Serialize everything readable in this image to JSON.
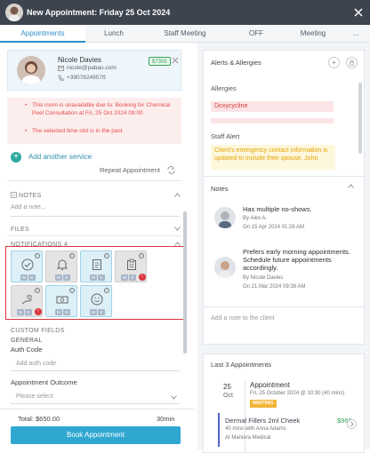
{
  "window": {
    "title": "New Appointment: Friday 25 Oct 2024"
  },
  "tabs": [
    {
      "label": "Appointments",
      "active": true
    },
    {
      "label": "Lunch"
    },
    {
      "label": "Staff Meeting"
    },
    {
      "label": "OFF"
    },
    {
      "label": "Meeting"
    },
    {
      "label": "..."
    }
  ],
  "client": {
    "name": "Nicole Davies",
    "email": "nicole@pabau.com",
    "phone": "+3907824957б",
    "balance": "$7355"
  },
  "warnings": [
    "This room is unavailable due to: Booking for Chemical Peel Consultation at Fri, 25 Oct 2024 09:00",
    "The selected time slot is in the past."
  ],
  "actions": {
    "add_service": "Add another service",
    "repeat": "Repeat Appointment"
  },
  "notes_section": {
    "label": "NOTES",
    "placeholder": "Add a note..."
  },
  "files_section": {
    "label": "FILES"
  },
  "notifications": {
    "label": "NOTIFICATIONS",
    "count": "4",
    "tiles": [
      {
        "icon": "check-circle-icon",
        "state": "on",
        "chips": [
          "M",
          "E"
        ],
        "error": ""
      },
      {
        "icon": "bell-icon",
        "state": "off",
        "chips": [
          "M",
          "E"
        ],
        "error": ""
      },
      {
        "icon": "document-icon",
        "state": "on",
        "chips": [
          "M",
          "E"
        ],
        "error": ""
      },
      {
        "icon": "clipboard-icon",
        "state": "off",
        "chips": [
          "M",
          "E"
        ],
        "error": "!"
      },
      {
        "icon": "hand-heart-icon",
        "state": "off",
        "chips": [
          "M",
          "E"
        ],
        "error": "!"
      },
      {
        "icon": "cash-icon",
        "state": "on",
        "chips": [
          "M",
          "E"
        ],
        "error": ""
      },
      {
        "icon": "smile-icon",
        "state": "on",
        "chips": [
          "M",
          "E"
        ],
        "error": ""
      }
    ]
  },
  "custom_fields": {
    "label": "CUSTOM FIELDS",
    "general": "GENERAL",
    "auth_label": "Auth Code",
    "auth_placeholder": "Add auth code",
    "outcome_label": "Appointment Outcome",
    "outcome_placeholder": "Please select"
  },
  "footer": {
    "total": "Total: $650.00",
    "duration": "30min",
    "book": "Book Appointment"
  },
  "alerts": {
    "title": "Alerts & Allergies",
    "allergies_label": "Allergies",
    "allergies": [
      "Doxycycline",
      ""
    ],
    "staff_alert_label": "Staff Alert",
    "staff_alert": "Client's emergency contact information is updated to include their spouse, John"
  },
  "notes_panel": {
    "title": "Notes",
    "items": [
      {
        "text": "Has multiple no-shows.",
        "by": "By Alex A.",
        "date": "On 15 Apr 2024 01:26 AM"
      },
      {
        "text": "Prefers early morning appointments. Schedule future appointments accordingly.",
        "by": "By Nicole Davies",
        "date": "On 21 Mar 2024 09:38 AM"
      }
    ],
    "input_placeholder": "Add a note to the client"
  },
  "last_appointments": {
    "title": "Last 3 Appointments",
    "day": "25",
    "month": "Oct",
    "appt_title": "Appointment",
    "appt_when": "Fri, 25 October 2024 @ 10:30 (40 mins)",
    "status": "WAITING",
    "service": "Dermal Fillers 2ml Cheek",
    "service_price": "$960",
    "service_detail": "40 mins with Anna Adams",
    "service_location": "At Maniera Medical"
  },
  "colors": {
    "accent": "#2f8ec7",
    "book_button": "#2fa7d1",
    "error": "#d9343d",
    "success": "#37a15c",
    "title_bar": "#3d4450"
  }
}
